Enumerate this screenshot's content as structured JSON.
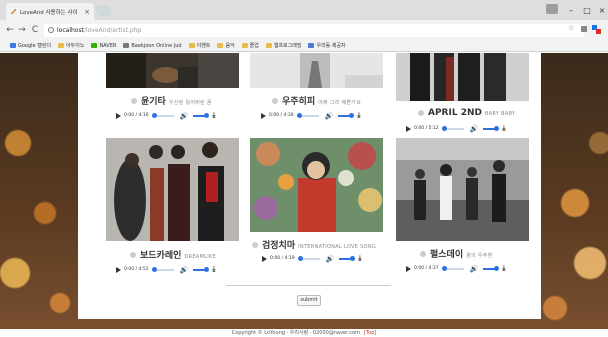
{
  "browser": {
    "tab_title": "LoveAnd 사용하는 사이",
    "tab_close": "×",
    "min": "–",
    "max": "□",
    "close": "×",
    "back": "←",
    "forward": "→",
    "reload": "C",
    "url_host": "localhost",
    "url_path": "/loveAnd/artist.php",
    "star": "☆"
  },
  "bookmarks": [
    {
      "label": "Google 캘린더",
      "color": "#3b78e7"
    },
    {
      "label": "아두이노",
      "color": "#e9b949"
    },
    {
      "label": "NAVER",
      "color": "#2db400"
    },
    {
      "label": "Baekjoon Online Jud",
      "color": "#777777"
    },
    {
      "label": "이벤트",
      "color": "#e9b949"
    },
    {
      "label": "음악",
      "color": "#e9b949"
    },
    {
      "label": "졸업",
      "color": "#e9b949"
    },
    {
      "label": "웹프로그래밍",
      "color": "#e9b949"
    },
    {
      "label": "우리동 제공자",
      "color": "#4a7bd0"
    }
  ],
  "artists": [
    {
      "name": "윤기타",
      "sub": "우산을 잃어버린 꿈",
      "time": "0:00 / 4:16"
    },
    {
      "name": "우주히피",
      "sub": "어쩌 그리 예쁜가요",
      "time": "0:00 / 4:30"
    },
    {
      "name": "APRIL 2ND",
      "sub": "BABY BABY",
      "time": "0:00 / 5:12"
    },
    {
      "name": "보드카레인",
      "sub": "DREAMLIKE",
      "time": "0:00 / 4:52"
    },
    {
      "name": "검정치마",
      "sub": "INTERNATIONAL LOVE SONG",
      "time": "0:00 / 4:19"
    },
    {
      "name": "펄스데이",
      "sub": "꿈의 우주편",
      "time": "0:00 / 4:37"
    }
  ],
  "submit_label": "submit",
  "footer": {
    "text": "Copyright © LoYoung · 우리사랑 · 02000@naver.com",
    "top_link": "[Top]"
  }
}
